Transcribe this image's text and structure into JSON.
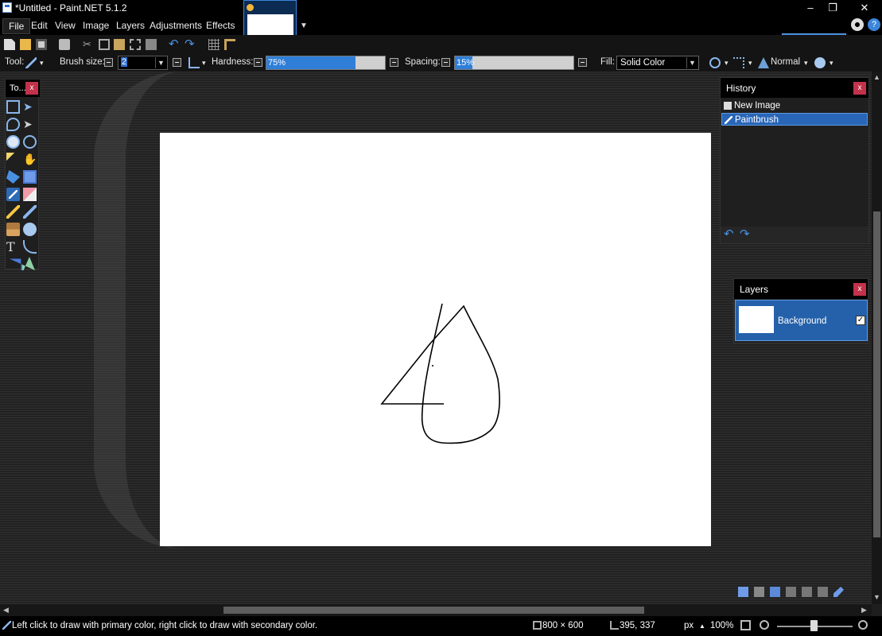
{
  "window": {
    "title": "*Untitled - Paint.NET 5.1.2",
    "minimize": "–",
    "restore": "❐",
    "close": "✕"
  },
  "menu": {
    "items": [
      "File",
      "Edit",
      "View",
      "Image",
      "Layers",
      "Adjustments",
      "Effects"
    ]
  },
  "toolbar": {
    "tool_label": "Tool:",
    "brush_size_label": "Brush size:",
    "brush_size_value": "2",
    "hardness_label": "Hardness:",
    "hardness_value": "75%",
    "hardness_level": 0.75,
    "spacing_label": "Spacing:",
    "spacing_value": "15%",
    "spacing_level": 0.15,
    "fill_label": "Fill:",
    "fill_value": "Solid Color",
    "blend_mode": "Normal"
  },
  "tools_window": {
    "title": "To...",
    "close": "x",
    "active_tool": "paintbrush"
  },
  "history": {
    "title": "History",
    "close": "x",
    "items": [
      {
        "label": "New Image",
        "selected": false
      },
      {
        "label": "Paintbrush",
        "selected": true
      }
    ]
  },
  "layers": {
    "title": "Layers",
    "close": "x",
    "items": [
      {
        "name": "Background",
        "visible": true,
        "selected": true
      }
    ]
  },
  "status": {
    "hint": "Left click to draw with primary color, right click to draw with secondary color.",
    "image_size": "800 × 600",
    "cursor_pos": "395, 337",
    "units": "px",
    "zoom": "100%"
  },
  "colors": {
    "accent": "#2f7fd8",
    "close_red": "#c4314b",
    "selection_blue": "#2561ab"
  }
}
